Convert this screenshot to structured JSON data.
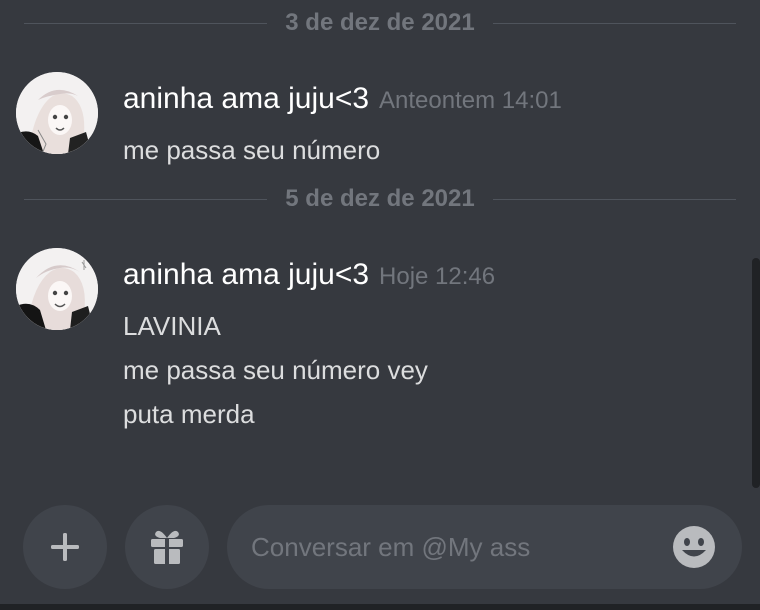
{
  "dividers": [
    {
      "date": "3 de dez de 2021"
    },
    {
      "date": "5 de dez de 2021"
    }
  ],
  "messages": [
    {
      "author": "aninha ama juju<3",
      "timestamp": "Anteontem 14:01",
      "lines": [
        "me passa seu número"
      ]
    },
    {
      "author": "aninha ama juju<3",
      "timestamp": "Hoje 12:46",
      "lines": [
        "LAVINIA",
        "me passa seu número vey",
        "puta merda"
      ]
    }
  ],
  "composer": {
    "placeholder": "Conversar em @My ass",
    "add_icon": "plus-icon",
    "gift_icon": "gift-icon",
    "emoji_icon": "emoji-icon"
  },
  "colors": {
    "background": "#36393f",
    "input_bg": "#40444b",
    "muted_text": "#72767d",
    "username": "#ffffff"
  }
}
